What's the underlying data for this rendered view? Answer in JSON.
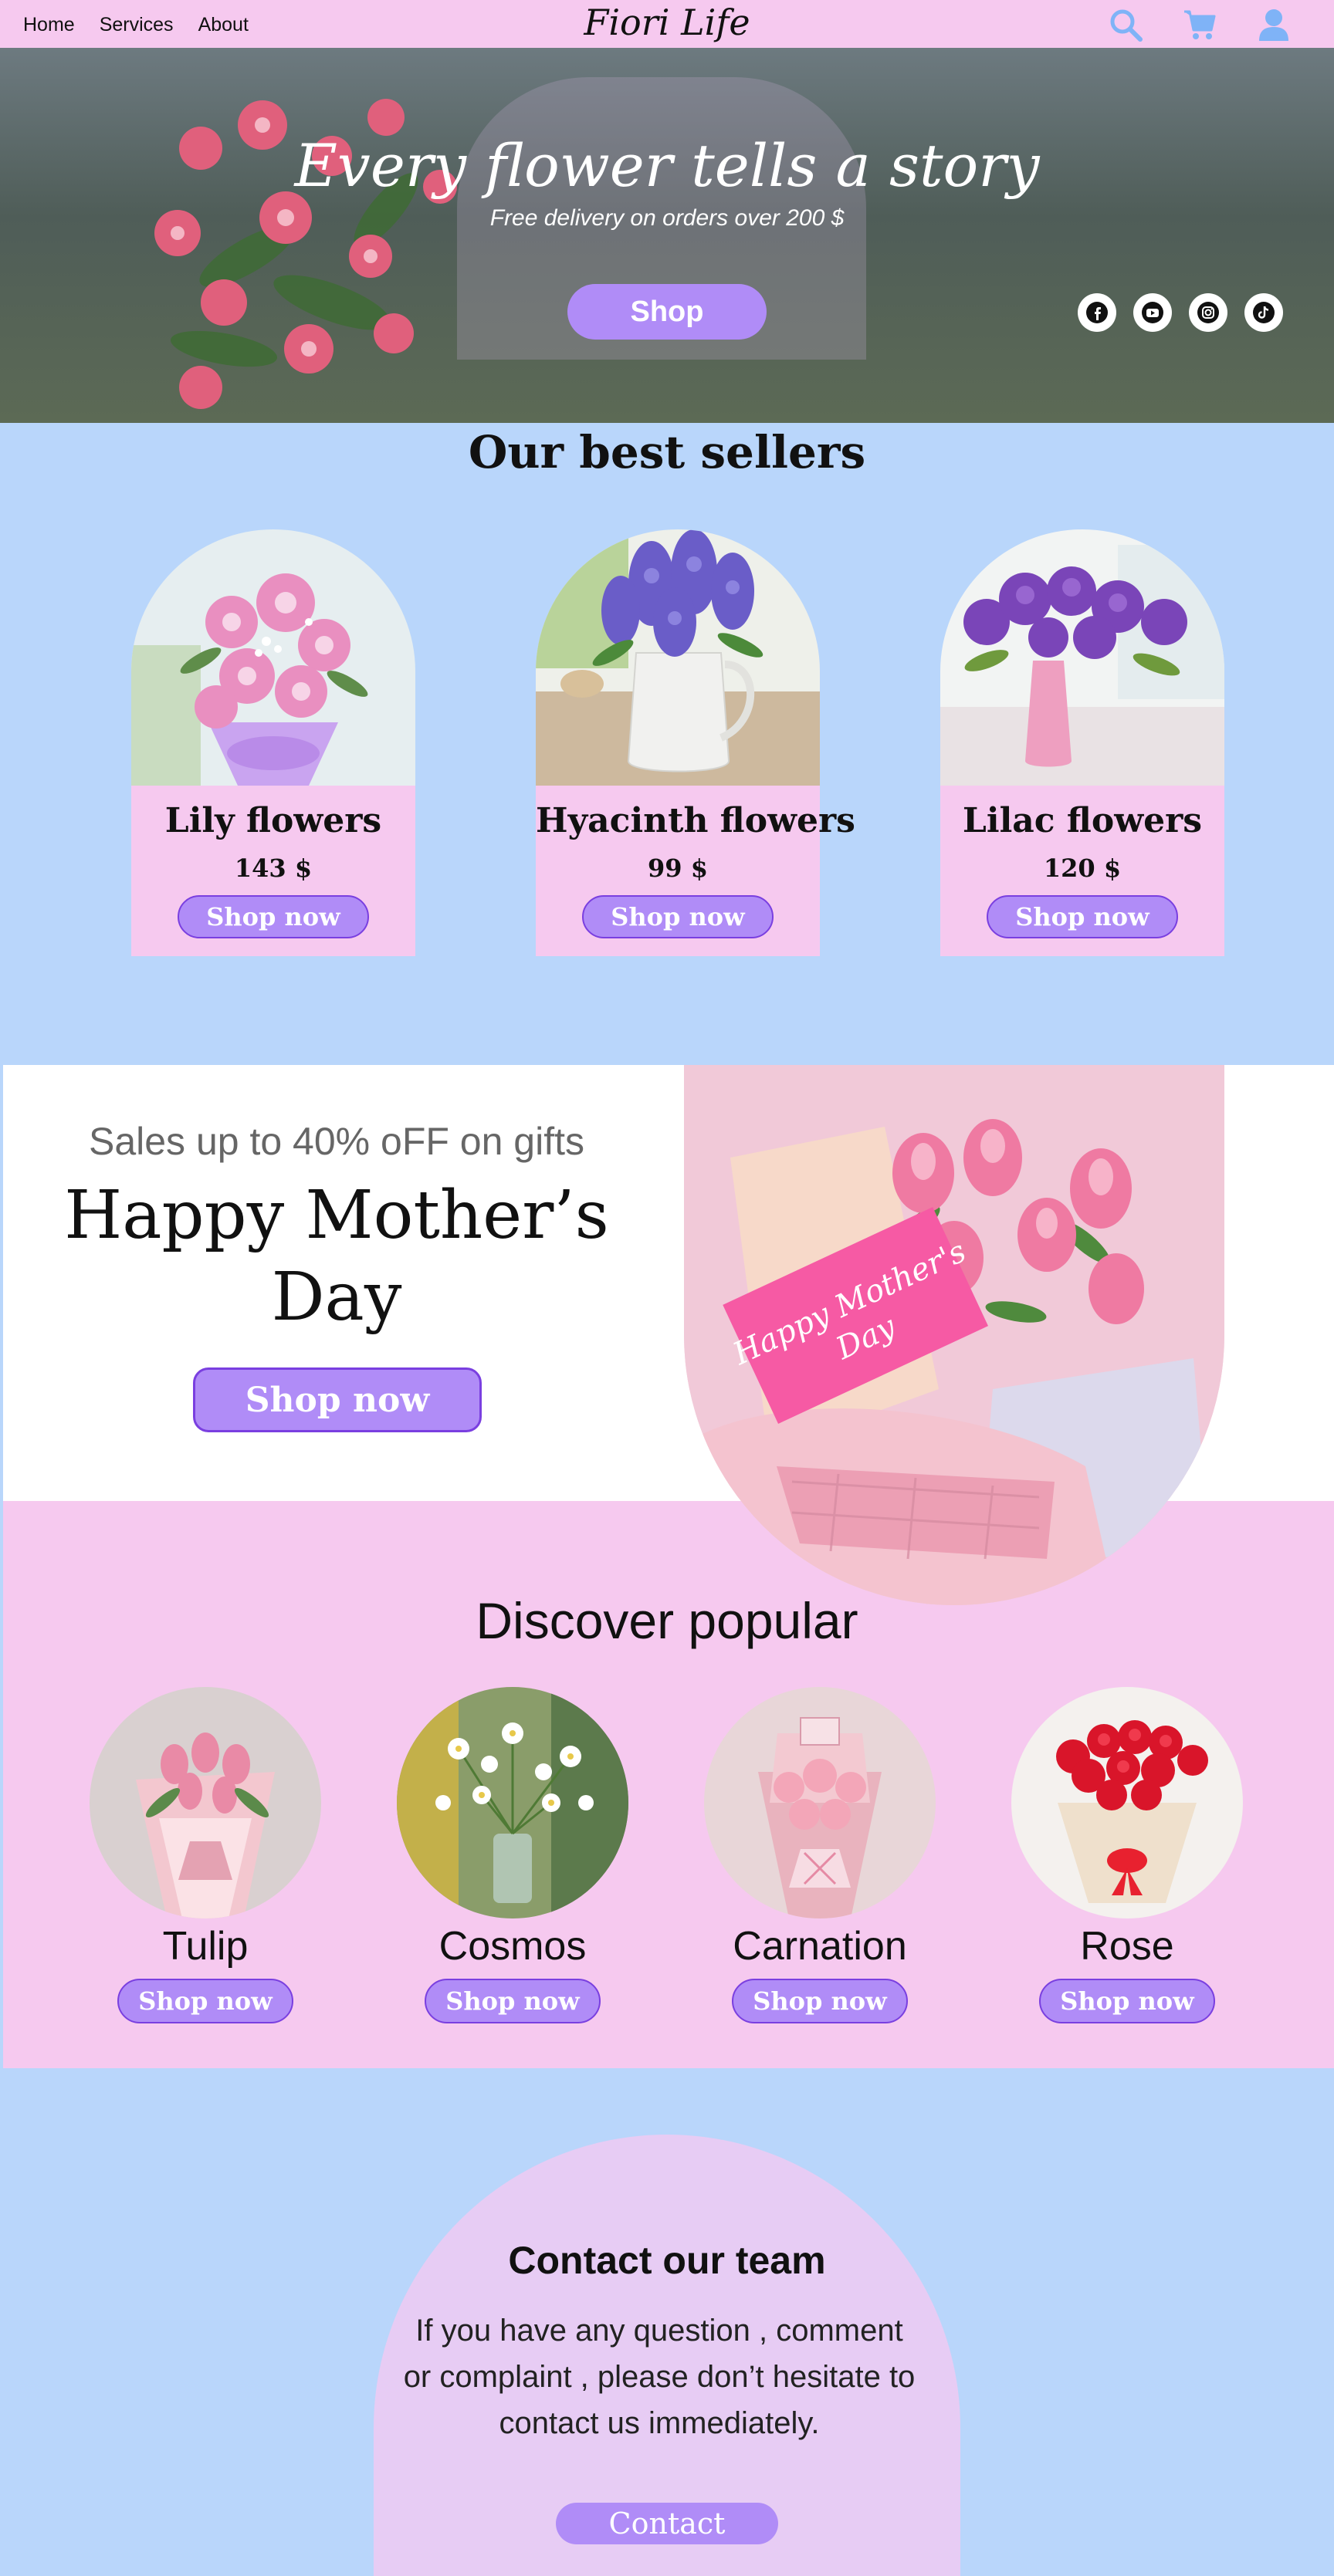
{
  "nav": {
    "links": [
      "Home",
      "Services",
      "About"
    ],
    "brand": "Fiori Life",
    "icons": [
      "search-icon",
      "cart-icon",
      "user-icon"
    ],
    "icon_color": "#7fb3f7"
  },
  "hero": {
    "title": "Every flower tells a story",
    "subtitle": "Free delivery on orders over 200 $",
    "button": "Shop",
    "socials": [
      "facebook-icon",
      "youtube-icon",
      "instagram-icon",
      "tiktok-icon"
    ]
  },
  "best_sellers": {
    "title": "Our best sellers",
    "items": [
      {
        "name": "Lily flowers",
        "price": "143 $",
        "button": "Shop now"
      },
      {
        "name": "Hyacinth flowers",
        "price": "99 $",
        "button": "Shop now"
      },
      {
        "name": "Lilac flowers",
        "price": "120 $",
        "button": "Shop now"
      }
    ]
  },
  "promo": {
    "subtitle": "Sales up to 40% oFF on gifts",
    "title": "Happy Mother’s Day",
    "button": "Shop now",
    "card_text": "Happy Mother's Day"
  },
  "discover": {
    "title": "Discover popular",
    "items": [
      {
        "name": "Tulip",
        "button": "Shop now"
      },
      {
        "name": "Cosmos",
        "button": "Shop now"
      },
      {
        "name": "Carnation",
        "button": "Shop now"
      },
      {
        "name": "Rose",
        "button": "Shop now"
      }
    ]
  },
  "contact": {
    "title": "Contact our team",
    "text": "If you have any question , comment or complaint , please don’t hesitate to contact us immediately.",
    "button": "Contact"
  },
  "colors": {
    "pink": "#f6c9ef",
    "blue": "#b9d6fb",
    "purple_button": "#b08cf7",
    "purple_border": "#7a3fe0",
    "lavender": "#e7ccf4"
  }
}
